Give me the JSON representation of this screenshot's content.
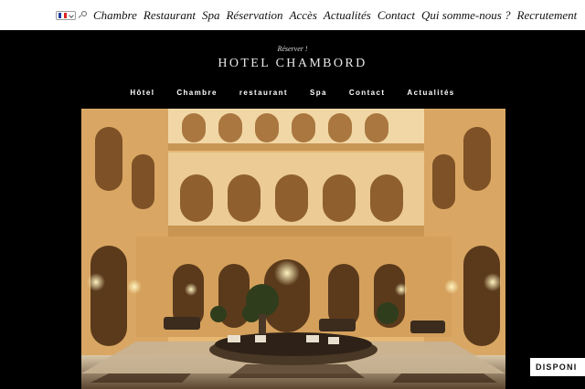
{
  "topbar": {
    "language": "FR",
    "nav": [
      "Chambre",
      "Restaurant",
      "Spa",
      "Réservation",
      "Accès",
      "Actualités",
      "Contact",
      "Qui somme-nous ?",
      "Recrutement"
    ]
  },
  "header": {
    "reserver": "Réserver !",
    "brand": "HOTEL CHAMBORD"
  },
  "main_nav": [
    "Hôtel",
    "Chambre",
    "restaurant",
    "Spa",
    "Contact",
    "Actualités"
  ],
  "hero": {
    "alt": "hotel-lobby-photo"
  },
  "badge": {
    "label": "DISPONI"
  },
  "colors": {
    "bg": "#000000",
    "topbar": "#ffffff",
    "nav_text": "#111111",
    "accent_warm": "#e2b873"
  }
}
